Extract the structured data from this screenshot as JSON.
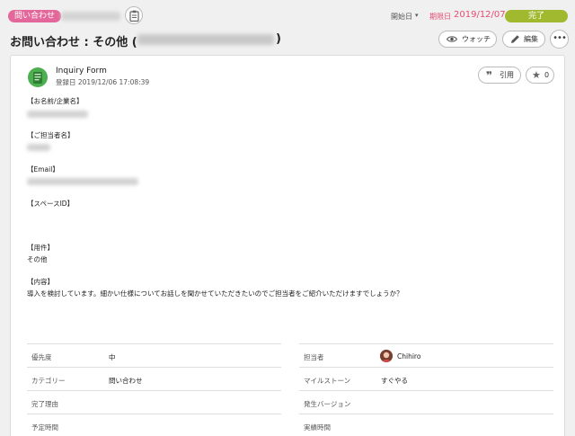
{
  "header": {
    "category_tag": "問い合わせ",
    "start_label": "開始日",
    "start_arrow": "▾",
    "due_label": "期限日",
    "due_date": "2019/12/07",
    "status": "完了",
    "title": "お問い合わせ : その他 (",
    "title_close": ")",
    "watch_label": "ウォッチ",
    "edit_label": "編集",
    "more_label": "•••"
  },
  "post": {
    "author": "Inquiry Form",
    "registered": "登録日 2019/12/06 17:08:39",
    "quote_label": "引用",
    "star_count": "0",
    "lines": {
      "name_heading": "【お名前/企業名】",
      "person_heading": "【ご担当者名】",
      "email_heading": "【Email】",
      "space_heading": "【スペースID】",
      "subject_heading": "【用件】",
      "subject_value": "その他",
      "content_heading": "【内容】",
      "content_value": "導入を検討しています。細かい仕様についてお話しを聞かせていただきたいのでご担当者をご紹介いただけますでしょうか？"
    }
  },
  "properties": {
    "left": [
      {
        "key": "優先度",
        "value": "中"
      },
      {
        "key": "カテゴリー",
        "value": "問い合わせ"
      },
      {
        "key": "完了理由",
        "value": ""
      },
      {
        "key": "予定時間",
        "value": ""
      }
    ],
    "right": [
      {
        "key": "担当者",
        "value": "Chihiro"
      },
      {
        "key": "マイルストーン",
        "value": "すぐやる"
      },
      {
        "key": "発生バージョン",
        "value": ""
      },
      {
        "key": "実績時間",
        "value": ""
      }
    ]
  },
  "colors": {
    "category_tag": "#e3679a",
    "due": "#e64c72",
    "status_done": "#a1b92f"
  },
  "icons": {
    "clipboard": "clipboard-icon",
    "watch": "eye-icon",
    "edit": "pencil-icon",
    "quote": "quote-icon",
    "star": "star-icon"
  }
}
